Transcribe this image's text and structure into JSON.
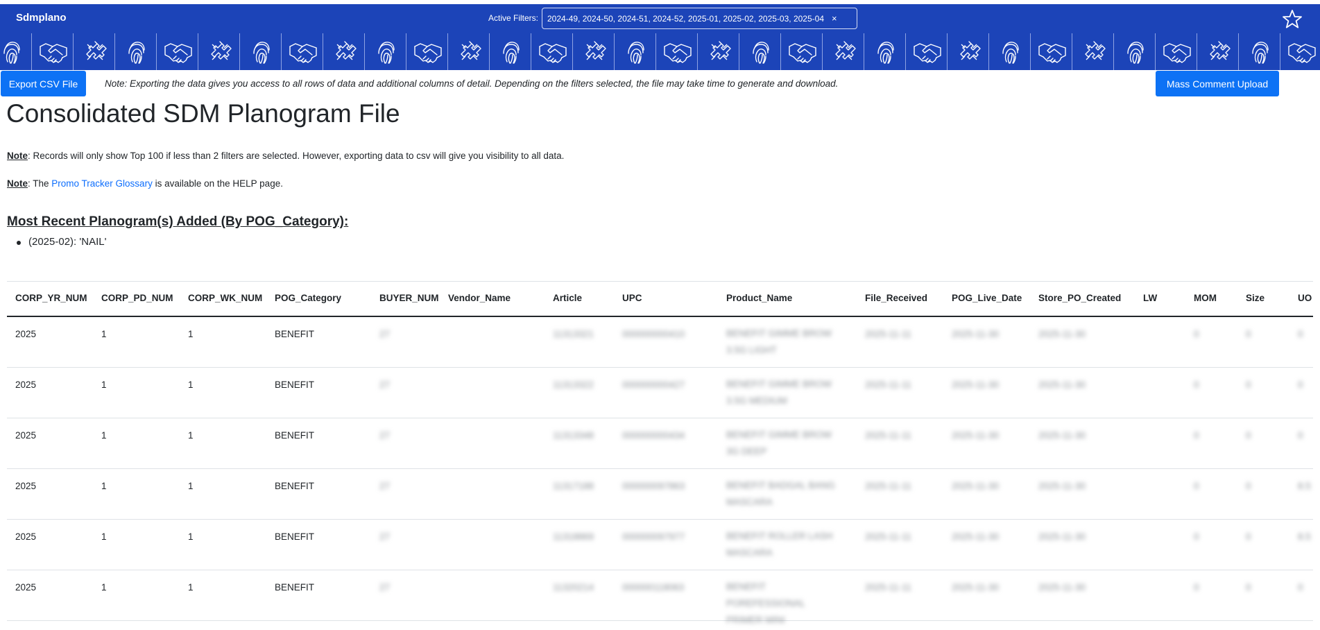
{
  "app": {
    "title": "Sdmplano"
  },
  "filters": {
    "label": "Active Filters:",
    "value": "2024-49, 2024-50, 2024-51, 2024-52, 2025-01, 2025-02, 2025-03, 2025-04",
    "clear_symbol": "×"
  },
  "favorite_icon": "star-outline-icon",
  "banner_icons": [
    "fingerprint-icon",
    "handshake-icon",
    "puzzle-hands-icon"
  ],
  "colors": {
    "brand_blue": "#1c44b8",
    "button_blue": "#0d72f5",
    "link_blue": "#0d6efd"
  },
  "actions": {
    "export_label": "Export CSV File",
    "export_note": "Note: Exporting the data gives you access to all rows of data and additional columns of detail. Depending on the filters selected, the file may take time to generate and download.",
    "mass_upload_label": "Mass Comment Upload"
  },
  "page_title": "Consolidated SDM Planogram File",
  "notes": {
    "note_label": "Note",
    "note1_text": ": Records will only show Top 100 if less than 2 filters are selected. However, exporting data to csv will give you visibility to all data.",
    "note2_prefix": ": The ",
    "note2_link": "Promo Tracker Glossary",
    "note2_suffix": " is available on the HELP page."
  },
  "recent": {
    "heading": "Most Recent Planogram(s) Added (By POG_Category):",
    "items": [
      "(2025-02): 'NAIL'"
    ]
  },
  "table": {
    "columns": [
      "CORP_YR_NUM",
      "CORP_PD_NUM",
      "CORP_WK_NUM",
      "POG_Category",
      "BUYER_NUM",
      "Vendor_Name",
      "Article",
      "UPC",
      "Product_Name",
      "File_Received",
      "POG_Live_Date",
      "Store_PO_Created",
      "LW",
      "MOM",
      "Size",
      "UO"
    ],
    "rows": [
      {
        "yr": "2025",
        "pd": "1",
        "wk": "1",
        "cat": "BENEFIT",
        "buyer": "27",
        "article": "11313321",
        "upc": "000000000410",
        "product": "BENEFIT GIMME BROW 3.5G LIGHT",
        "file": "2025-11-11",
        "live": "2025-11-30",
        "po": "2025-11-30",
        "lw": "0",
        "mom": "0",
        "size": "0"
      },
      {
        "yr": "2025",
        "pd": "1",
        "wk": "1",
        "cat": "BENEFIT",
        "buyer": "27",
        "article": "11313322",
        "upc": "000000000427",
        "product": "BENEFIT GIMME BROW 3.5G MEDIUM",
        "file": "2025-11-11",
        "live": "2025-11-30",
        "po": "2025-11-30",
        "lw": "0",
        "mom": "0",
        "size": "0"
      },
      {
        "yr": "2025",
        "pd": "1",
        "wk": "1",
        "cat": "BENEFIT",
        "buyer": "27",
        "article": "11313348",
        "upc": "000000000434",
        "product": "BENEFIT GIMME BROW 3G DEEP",
        "file": "2025-11-11",
        "live": "2025-11-30",
        "po": "2025-11-30",
        "lw": "0",
        "mom": "0",
        "size": "0"
      },
      {
        "yr": "2025",
        "pd": "1",
        "wk": "1",
        "cat": "BENEFIT",
        "buyer": "27",
        "article": "11317188",
        "upc": "000000097863",
        "product": "BENEFIT BADGAL BANG MASCARA",
        "file": "2025-11-11",
        "live": "2025-11-30",
        "po": "2025-11-30",
        "lw": "0",
        "mom": "0",
        "size": "8.5"
      },
      {
        "yr": "2025",
        "pd": "1",
        "wk": "1",
        "cat": "BENEFIT",
        "buyer": "27",
        "article": "11318869",
        "upc": "000000097977",
        "product": "BENEFIT ROLLER LASH MASCARA",
        "file": "2025-11-11",
        "live": "2025-11-30",
        "po": "2025-11-30",
        "lw": "0",
        "mom": "0",
        "size": "8.5"
      },
      {
        "yr": "2025",
        "pd": "1",
        "wk": "1",
        "cat": "BENEFIT",
        "buyer": "27",
        "article": "11320214",
        "upc": "000000118063",
        "product": "BENEFIT POREFESSIONAL PRIMER MINI",
        "file": "2025-11-11",
        "live": "2025-11-30",
        "po": "2025-11-30",
        "lw": "0",
        "mom": "0",
        "size": "0"
      }
    ]
  }
}
